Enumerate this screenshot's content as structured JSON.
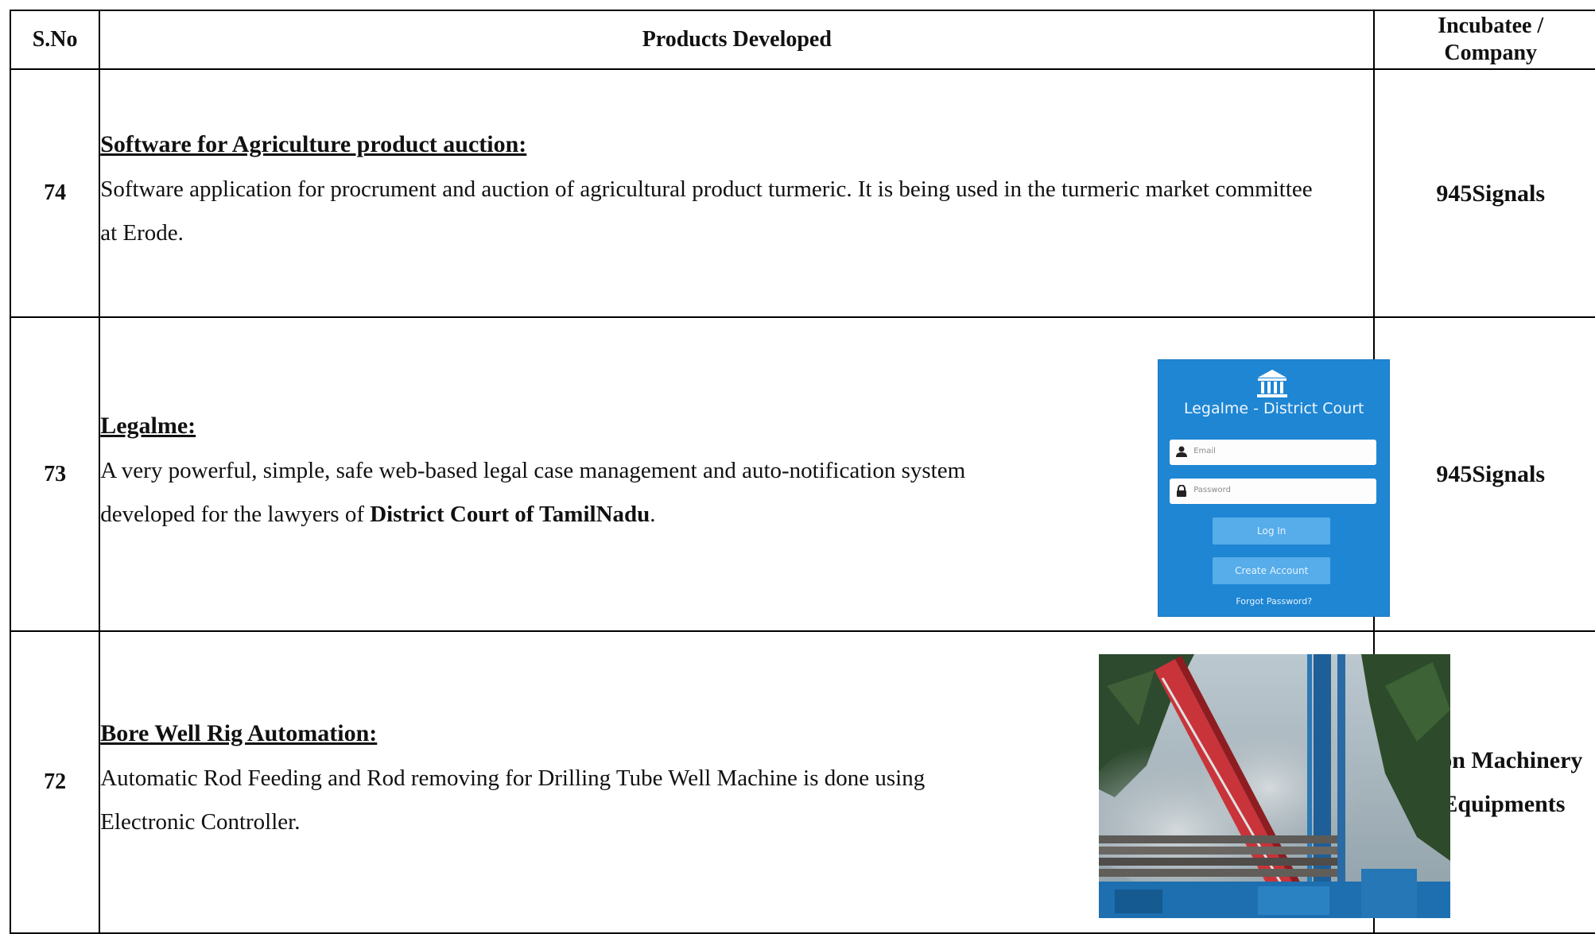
{
  "table": {
    "headers": {
      "sno": "S.No",
      "products": "Products Developed",
      "company_line1": "Incubatee /",
      "company_line2": "Company"
    },
    "rows": [
      {
        "sno": "74",
        "title": "Software for Agriculture product auction:",
        "description": "Software application for procrument and auction of agricultural product turmeric. It is being used in the turmeric market committee at Erode.",
        "company_line1": "945Signals",
        "company_line2": ""
      },
      {
        "sno": "73",
        "title": "Legalme:",
        "description_prefix": "A very powerful, simple, safe web-based legal case management and auto-notification system developed for the lawyers of ",
        "description_bold": "District Court of TamilNadu",
        "description_suffix": ".",
        "company_line1": "945Signals",
        "company_line2": "",
        "screenshot": {
          "title": "Legalme - District Court",
          "email_placeholder": "Email",
          "password_placeholder": "Password",
          "login_label": "Log In",
          "create_account_label": "Create Account",
          "forgot_label": "Forgot Password?",
          "bg_color": "#1f86d3",
          "button_color": "#56adea"
        }
      },
      {
        "sno": "72",
        "title": "Bore Well Rig Automation:",
        "description": "Automatic Rod Feeding and Rod removing for Drilling Tube Well Machine is done using Electronic Controller.",
        "company_line1": "Velson Machinery",
        "company_line2": "& Equipments"
      }
    ]
  }
}
